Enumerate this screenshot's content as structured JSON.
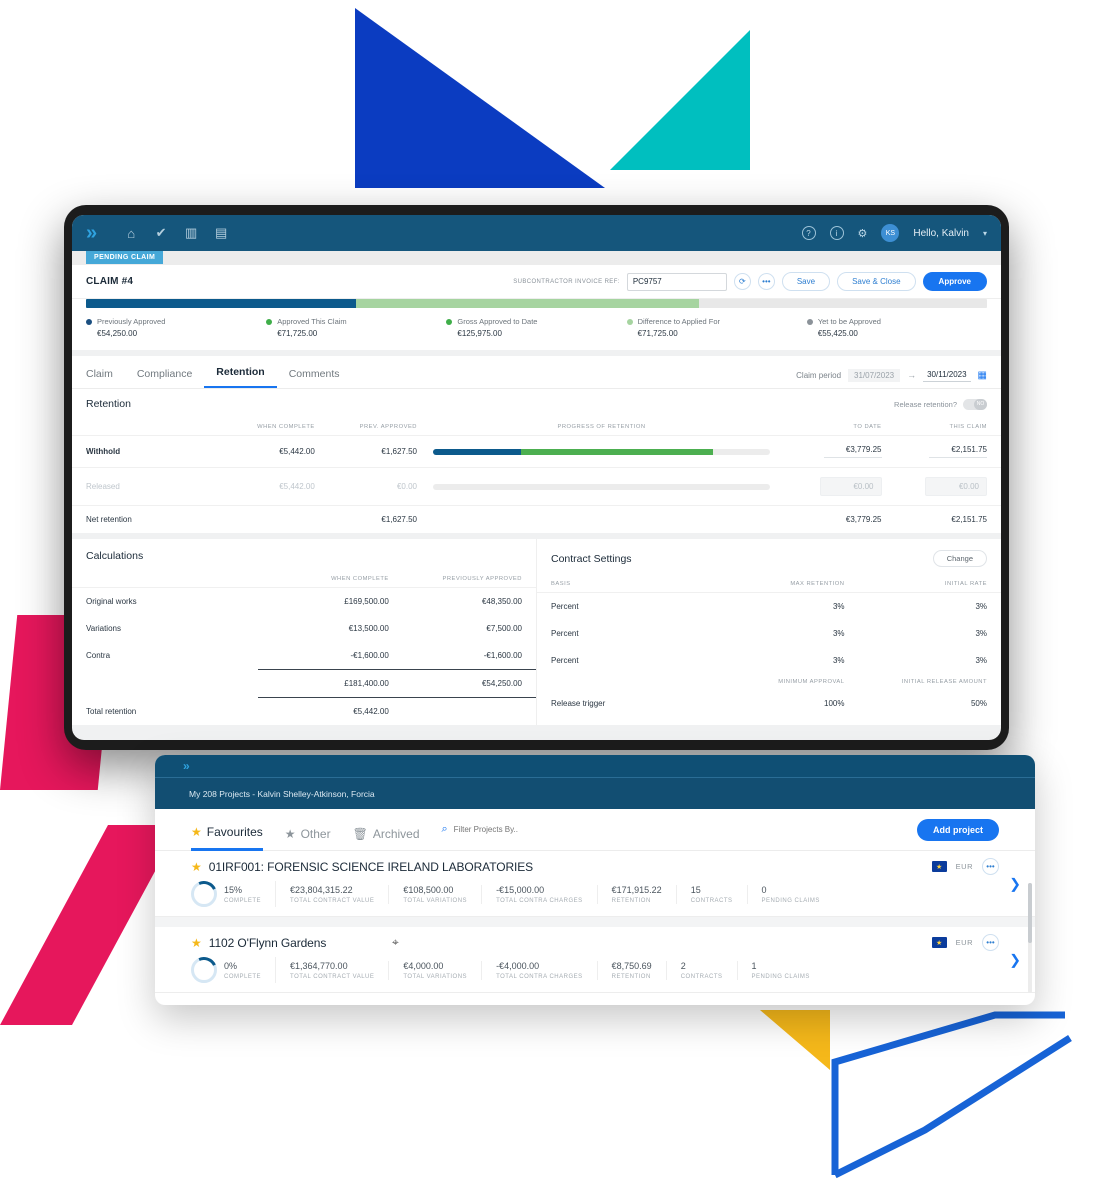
{
  "appbar": {
    "logo": "»",
    "nav_icons": [
      "home-icon",
      "check-icon",
      "chart-icon",
      "document-icon"
    ],
    "help_icon": "?",
    "info_icon": "i",
    "settings_icon": "⚙",
    "avatar_initials": "KS",
    "greeting": "Hello, Kalvin",
    "caret": "▾"
  },
  "claim": {
    "status_badge": "PENDING CLAIM",
    "title": "CLAIM #4",
    "invoice_label": "SUBCONTRACTOR INVOICE REF:",
    "invoice_value": "PC9757",
    "invoice_placeholder": "PC9757",
    "history_icon": "⟳",
    "more_icon": "•••",
    "save_label": "Save",
    "save_close_label": "Save & Close",
    "approve_label": "Approve"
  },
  "summary": {
    "bar": {
      "previously_approved_pct": 30,
      "approved_this_claim_pct": 38
    },
    "items": [
      {
        "label": "Previously Approved",
        "value": "€54,250.00",
        "color": "#1b4f80"
      },
      {
        "label": "Approved This Claim",
        "value": "€71,725.00",
        "color": "#3fae49"
      },
      {
        "label": "Gross Approved to Date",
        "value": "€125,975.00",
        "color": "#3fae49"
      },
      {
        "label": "Difference to Applied For",
        "value": "€71,725.00",
        "color": "#a6d4a0"
      },
      {
        "label": "Yet to be Approved",
        "value": "€55,425.00",
        "color": "#8b9299"
      }
    ]
  },
  "tabs": [
    {
      "label": "Claim",
      "active": false
    },
    {
      "label": "Compliance",
      "active": false
    },
    {
      "label": "Retention",
      "active": true
    },
    {
      "label": "Comments",
      "active": false
    }
  ],
  "claim_period": {
    "label": "Claim period",
    "from": "31/07/2023",
    "arrow": "→",
    "to": "30/11/2023",
    "calendar_icon": "📅"
  },
  "retention": {
    "title": "Retention",
    "release_label": "Release retention?",
    "toggle_state": "NO",
    "columns": [
      "",
      "WHEN COMPLETE",
      "PREV. APPROVED",
      "PROGRESS OF RETENTION",
      "TO DATE",
      "THIS CLAIM"
    ],
    "rows": [
      {
        "name": "Withhold",
        "when_complete": "€5,442.00",
        "prev_approved": "€1,627.50",
        "bar": {
          "seg1": 26,
          "seg2": 57
        },
        "to_date": "€3,779.25",
        "this_claim": "€2,151.75",
        "muted": false,
        "inputs": false
      },
      {
        "name": "Released",
        "when_complete": "€5,442.00",
        "prev_approved": "€0.00",
        "bar": {
          "seg1": 0,
          "seg2": 0
        },
        "to_date": "€0.00",
        "this_claim": "€0.00",
        "muted": true,
        "inputs": true
      },
      {
        "name": "Net retention",
        "when_complete": "",
        "prev_approved": "€1,627.50",
        "bar": null,
        "to_date": "€3,779.25",
        "this_claim": "€2,151.75",
        "muted": false,
        "inputs": false
      }
    ]
  },
  "calculations": {
    "title": "Calculations",
    "columns": [
      "",
      "WHEN COMPLETE",
      "PREVIOUSLY APPROVED"
    ],
    "rows": [
      {
        "name": "Original works",
        "when_complete": "£169,500.00",
        "prev_approved": "€48,350.00"
      },
      {
        "name": "Variations",
        "when_complete": "€13,500.00",
        "prev_approved": "€7,500.00"
      },
      {
        "name": "Contra",
        "when_complete": "-€1,600.00",
        "prev_approved": "-€1,600.00"
      }
    ],
    "total_row": {
      "name": "",
      "when_complete": "£181,400.00",
      "prev_approved": "€54,250.00"
    },
    "retention_row": {
      "name": "Total retention",
      "when_complete": "€5,442.00",
      "prev_approved": ""
    }
  },
  "contract_settings": {
    "title": "Contract Settings",
    "change_label": "Change",
    "columns": [
      "BASIS",
      "MAX RETENTION",
      "INITIAL RATE"
    ],
    "rows": [
      {
        "basis": "Percent",
        "max_retention": "3%",
        "initial_rate": "3%"
      },
      {
        "basis": "Percent",
        "max_retention": "3%",
        "initial_rate": "3%"
      },
      {
        "basis": "Percent",
        "max_retention": "3%",
        "initial_rate": "3%"
      }
    ],
    "trigger_columns": [
      "",
      "MINIMUM APPROVAL",
      "INITIAL RELEASE AMOUNT"
    ],
    "trigger_row": {
      "name": "Release trigger",
      "minimum_approval": "100%",
      "initial_release_amount": "50%"
    }
  },
  "projects_overlay": {
    "logo": "»",
    "subtitle": "My 208 Projects - Kalvin Shelley-Atkinson, Forcia",
    "tabs": [
      {
        "label": "Favourites",
        "icon": "star-filled-icon",
        "active": true
      },
      {
        "label": "Other",
        "icon": "star-icon",
        "active": false
      },
      {
        "label": "Archived",
        "icon": "archive-icon",
        "active": false
      }
    ],
    "search_placeholder": "Filter Projects By..",
    "search_icon": "search-icon",
    "add_project_label": "Add project",
    "stat_labels": [
      "COMPLETE",
      "TOTAL CONTRACT VALUE",
      "TOTAL VARIATIONS",
      "TOTAL CONTRA CHARGES",
      "RETENTION",
      "CONTRACTS",
      "PENDING CLAIMS"
    ],
    "rows": [
      {
        "name": "01IRF001: FORENSIC SCIENCE IRELAND LABORATORIES",
        "currency": "EUR",
        "complete": "15%",
        "complete_pct": 15,
        "total_contract_value": "€23,804,315.22",
        "total_variations": "€108,500.00",
        "total_contra_charges": "-€15,000.00",
        "retention": "€171,915.22",
        "contracts": "15",
        "pending_claims": "0"
      },
      {
        "name": "1102  O'Flynn Gardens",
        "currency": "EUR",
        "complete": "0%",
        "complete_pct": 0,
        "total_contract_value": "€1,364,770.00",
        "total_variations": "€4,000.00",
        "total_contra_charges": "-€4,000.00",
        "retention": "€8,750.69",
        "contracts": "2",
        "pending_claims": "1"
      }
    ]
  },
  "colors": {
    "brand_blue": "#1875f0",
    "nav_dark": "#15567c",
    "overlay_dark": "#124e72",
    "green": "#4caf50",
    "deep_blue": "#0c5a8c",
    "deco_blue": "#0B3CC1",
    "deco_teal": "#00BFBF",
    "deco_pink": "#E6175C",
    "deco_yellow": "#F5B81A",
    "star_gold": "#f5b81a"
  }
}
